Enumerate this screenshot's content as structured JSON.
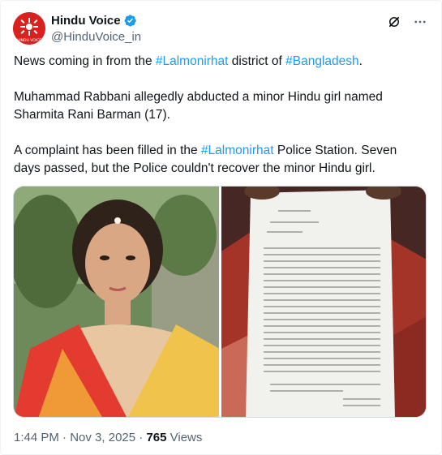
{
  "author": {
    "name": "Hindu Voice",
    "handle": "@HinduVoice_in",
    "avatar_text": "HINDU VOICE"
  },
  "post": {
    "p1_prefix": "News coming in from the ",
    "p1_tag1": "#Lalmonirhat",
    "p1_middle": " district of ",
    "p1_tag2": "#Bangladesh",
    "p1_suffix": ".",
    "p2": "Muhammad Rabbani allegedly abducted a minor Hindu girl named Sharmita Rani Barman (17).",
    "p3_prefix": "A complaint has been filled in the ",
    "p3_tag": "#Lalmonirhat",
    "p3_suffix": " Police Station. Seven days passed, but the Police couldn't recover the minor Hindu girl."
  },
  "meta": {
    "time": "1:44 PM",
    "sep": " · ",
    "date": "Nov 3, 2025",
    "views_count": "765",
    "views_label": " Views"
  },
  "icons": {
    "verified": "verified-badge-icon",
    "grok": "grok-icon",
    "more": "more-icon"
  },
  "colors": {
    "accent": "#1d9bf0",
    "text": "#0f1419",
    "muted": "#536471",
    "avatar_bg": "#d9211f"
  }
}
